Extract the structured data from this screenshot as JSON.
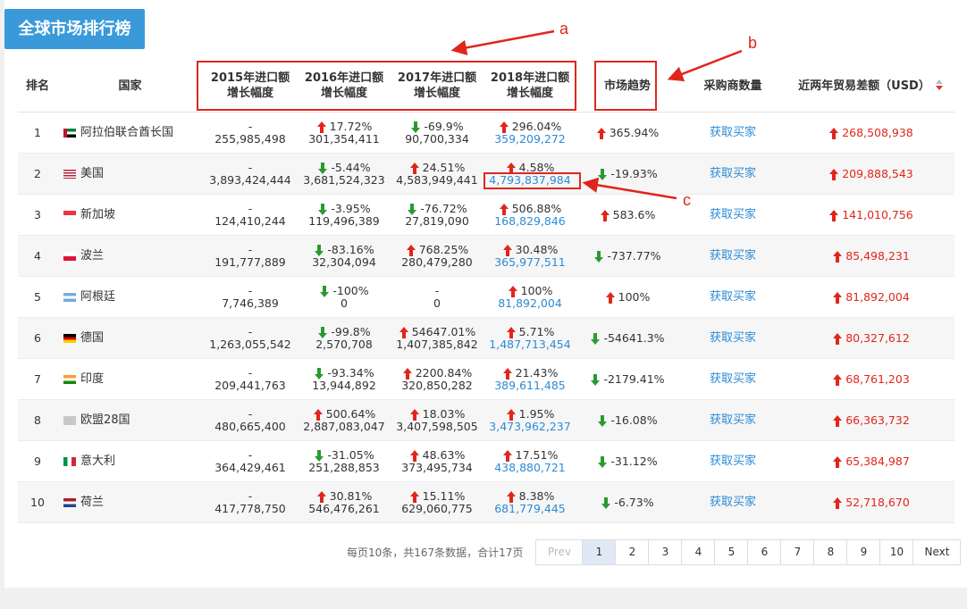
{
  "title": "全球市场排行榜",
  "headers": {
    "rank": "排名",
    "country": "国家",
    "y2015": [
      "2015年进口额",
      "增长幅度"
    ],
    "y2016": [
      "2016年进口额",
      "增长幅度"
    ],
    "y2017": [
      "2017年进口额",
      "增长幅度"
    ],
    "y2018": [
      "2018年进口额",
      "增长幅度"
    ],
    "trend": "市场趋势",
    "buyers": "采购商数量",
    "diff": "近两年贸易差额（USD）"
  },
  "buyer_link": "获取买家",
  "rows": [
    {
      "rank": "1",
      "flag": "ae",
      "country": "阿拉伯联合酋长国",
      "c2015": {
        "pct": "-",
        "dir": "",
        "val": "255,985,498"
      },
      "c2016": {
        "pct": "17.72%",
        "dir": "up",
        "val": "301,354,411"
      },
      "c2017": {
        "pct": "-69.9%",
        "dir": "down",
        "val": "90,700,334"
      },
      "c2018": {
        "pct": "296.04%",
        "dir": "up",
        "val": "359,209,272"
      },
      "trend": {
        "pct": "365.94%",
        "dir": "up"
      },
      "diff": "268,508,938"
    },
    {
      "rank": "2",
      "flag": "us",
      "country": "美国",
      "c2015": {
        "pct": "-",
        "dir": "",
        "val": "3,893,424,444"
      },
      "c2016": {
        "pct": "-5.44%",
        "dir": "down",
        "val": "3,681,524,323"
      },
      "c2017": {
        "pct": "24.51%",
        "dir": "up",
        "val": "4,583,949,441"
      },
      "c2018": {
        "pct": "4.58%",
        "dir": "up",
        "val": "4,793,837,984"
      },
      "trend": {
        "pct": "-19.93%",
        "dir": "down"
      },
      "diff": "209,888,543"
    },
    {
      "rank": "3",
      "flag": "sg",
      "country": "新加坡",
      "c2015": {
        "pct": "-",
        "dir": "",
        "val": "124,410,244"
      },
      "c2016": {
        "pct": "-3.95%",
        "dir": "down",
        "val": "119,496,389"
      },
      "c2017": {
        "pct": "-76.72%",
        "dir": "down",
        "val": "27,819,090"
      },
      "c2018": {
        "pct": "506.88%",
        "dir": "up",
        "val": "168,829,846"
      },
      "trend": {
        "pct": "583.6%",
        "dir": "up"
      },
      "diff": "141,010,756"
    },
    {
      "rank": "4",
      "flag": "pl",
      "country": "波兰",
      "c2015": {
        "pct": "-",
        "dir": "",
        "val": "191,777,889"
      },
      "c2016": {
        "pct": "-83.16%",
        "dir": "down",
        "val": "32,304,094"
      },
      "c2017": {
        "pct": "768.25%",
        "dir": "up",
        "val": "280,479,280"
      },
      "c2018": {
        "pct": "30.48%",
        "dir": "up",
        "val": "365,977,511"
      },
      "trend": {
        "pct": "-737.77%",
        "dir": "down"
      },
      "diff": "85,498,231"
    },
    {
      "rank": "5",
      "flag": "ar",
      "country": "阿根廷",
      "c2015": {
        "pct": "-",
        "dir": "",
        "val": "7,746,389"
      },
      "c2016": {
        "pct": "-100%",
        "dir": "down",
        "val": "0"
      },
      "c2017": {
        "pct": "-",
        "dir": "",
        "val": "0"
      },
      "c2018": {
        "pct": "100%",
        "dir": "up",
        "val": "81,892,004"
      },
      "trend": {
        "pct": "100%",
        "dir": "up"
      },
      "diff": "81,892,004"
    },
    {
      "rank": "6",
      "flag": "de",
      "country": "德国",
      "c2015": {
        "pct": "-",
        "dir": "",
        "val": "1,263,055,542"
      },
      "c2016": {
        "pct": "-99.8%",
        "dir": "down",
        "val": "2,570,708"
      },
      "c2017": {
        "pct": "54647.01%",
        "dir": "up",
        "val": "1,407,385,842"
      },
      "c2018": {
        "pct": "5.71%",
        "dir": "up",
        "val": "1,487,713,454"
      },
      "trend": {
        "pct": "-54641.3%",
        "dir": "down"
      },
      "diff": "80,327,612"
    },
    {
      "rank": "7",
      "flag": "in",
      "country": "印度",
      "c2015": {
        "pct": "-",
        "dir": "",
        "val": "209,441,763"
      },
      "c2016": {
        "pct": "-93.34%",
        "dir": "down",
        "val": "13,944,892"
      },
      "c2017": {
        "pct": "2200.84%",
        "dir": "up",
        "val": "320,850,282"
      },
      "c2018": {
        "pct": "21.43%",
        "dir": "up",
        "val": "389,611,485"
      },
      "trend": {
        "pct": "-2179.41%",
        "dir": "down"
      },
      "diff": "68,761,203"
    },
    {
      "rank": "8",
      "flag": "eu",
      "country": "欧盟28国",
      "c2015": {
        "pct": "-",
        "dir": "",
        "val": "480,665,400"
      },
      "c2016": {
        "pct": "500.64%",
        "dir": "up",
        "val": "2,887,083,047"
      },
      "c2017": {
        "pct": "18.03%",
        "dir": "up",
        "val": "3,407,598,505"
      },
      "c2018": {
        "pct": "1.95%",
        "dir": "up",
        "val": "3,473,962,237"
      },
      "trend": {
        "pct": "-16.08%",
        "dir": "down"
      },
      "diff": "66,363,732"
    },
    {
      "rank": "9",
      "flag": "it",
      "country": "意大利",
      "c2015": {
        "pct": "-",
        "dir": "",
        "val": "364,429,461"
      },
      "c2016": {
        "pct": "-31.05%",
        "dir": "down",
        "val": "251,288,853"
      },
      "c2017": {
        "pct": "48.63%",
        "dir": "up",
        "val": "373,495,734"
      },
      "c2018": {
        "pct": "17.51%",
        "dir": "up",
        "val": "438,880,721"
      },
      "trend": {
        "pct": "-31.12%",
        "dir": "down"
      },
      "diff": "65,384,987"
    },
    {
      "rank": "10",
      "flag": "nl",
      "country": "荷兰",
      "c2015": {
        "pct": "-",
        "dir": "",
        "val": "417,778,750"
      },
      "c2016": {
        "pct": "30.81%",
        "dir": "up",
        "val": "546,476,261"
      },
      "c2017": {
        "pct": "15.11%",
        "dir": "up",
        "val": "629,060,775"
      },
      "c2018": {
        "pct": "8.38%",
        "dir": "up",
        "val": "681,779,445"
      },
      "trend": {
        "pct": "-6.73%",
        "dir": "down"
      },
      "diff": "52,718,670"
    }
  ],
  "pagination": {
    "info": "每页10条，共167条数据，合计17页",
    "prev": "Prev",
    "pages": [
      "1",
      "2",
      "3",
      "4",
      "5",
      "6",
      "7",
      "8",
      "9",
      "10"
    ],
    "current": "1",
    "next": "Next"
  },
  "annotations": {
    "a": "a",
    "b": "b",
    "c": "c"
  },
  "colors": {
    "accent": "#3a9ad9",
    "up": "#e0261c",
    "down": "#2a9a2e",
    "link": "#2b8bd6",
    "annotation": "#e0261c"
  }
}
